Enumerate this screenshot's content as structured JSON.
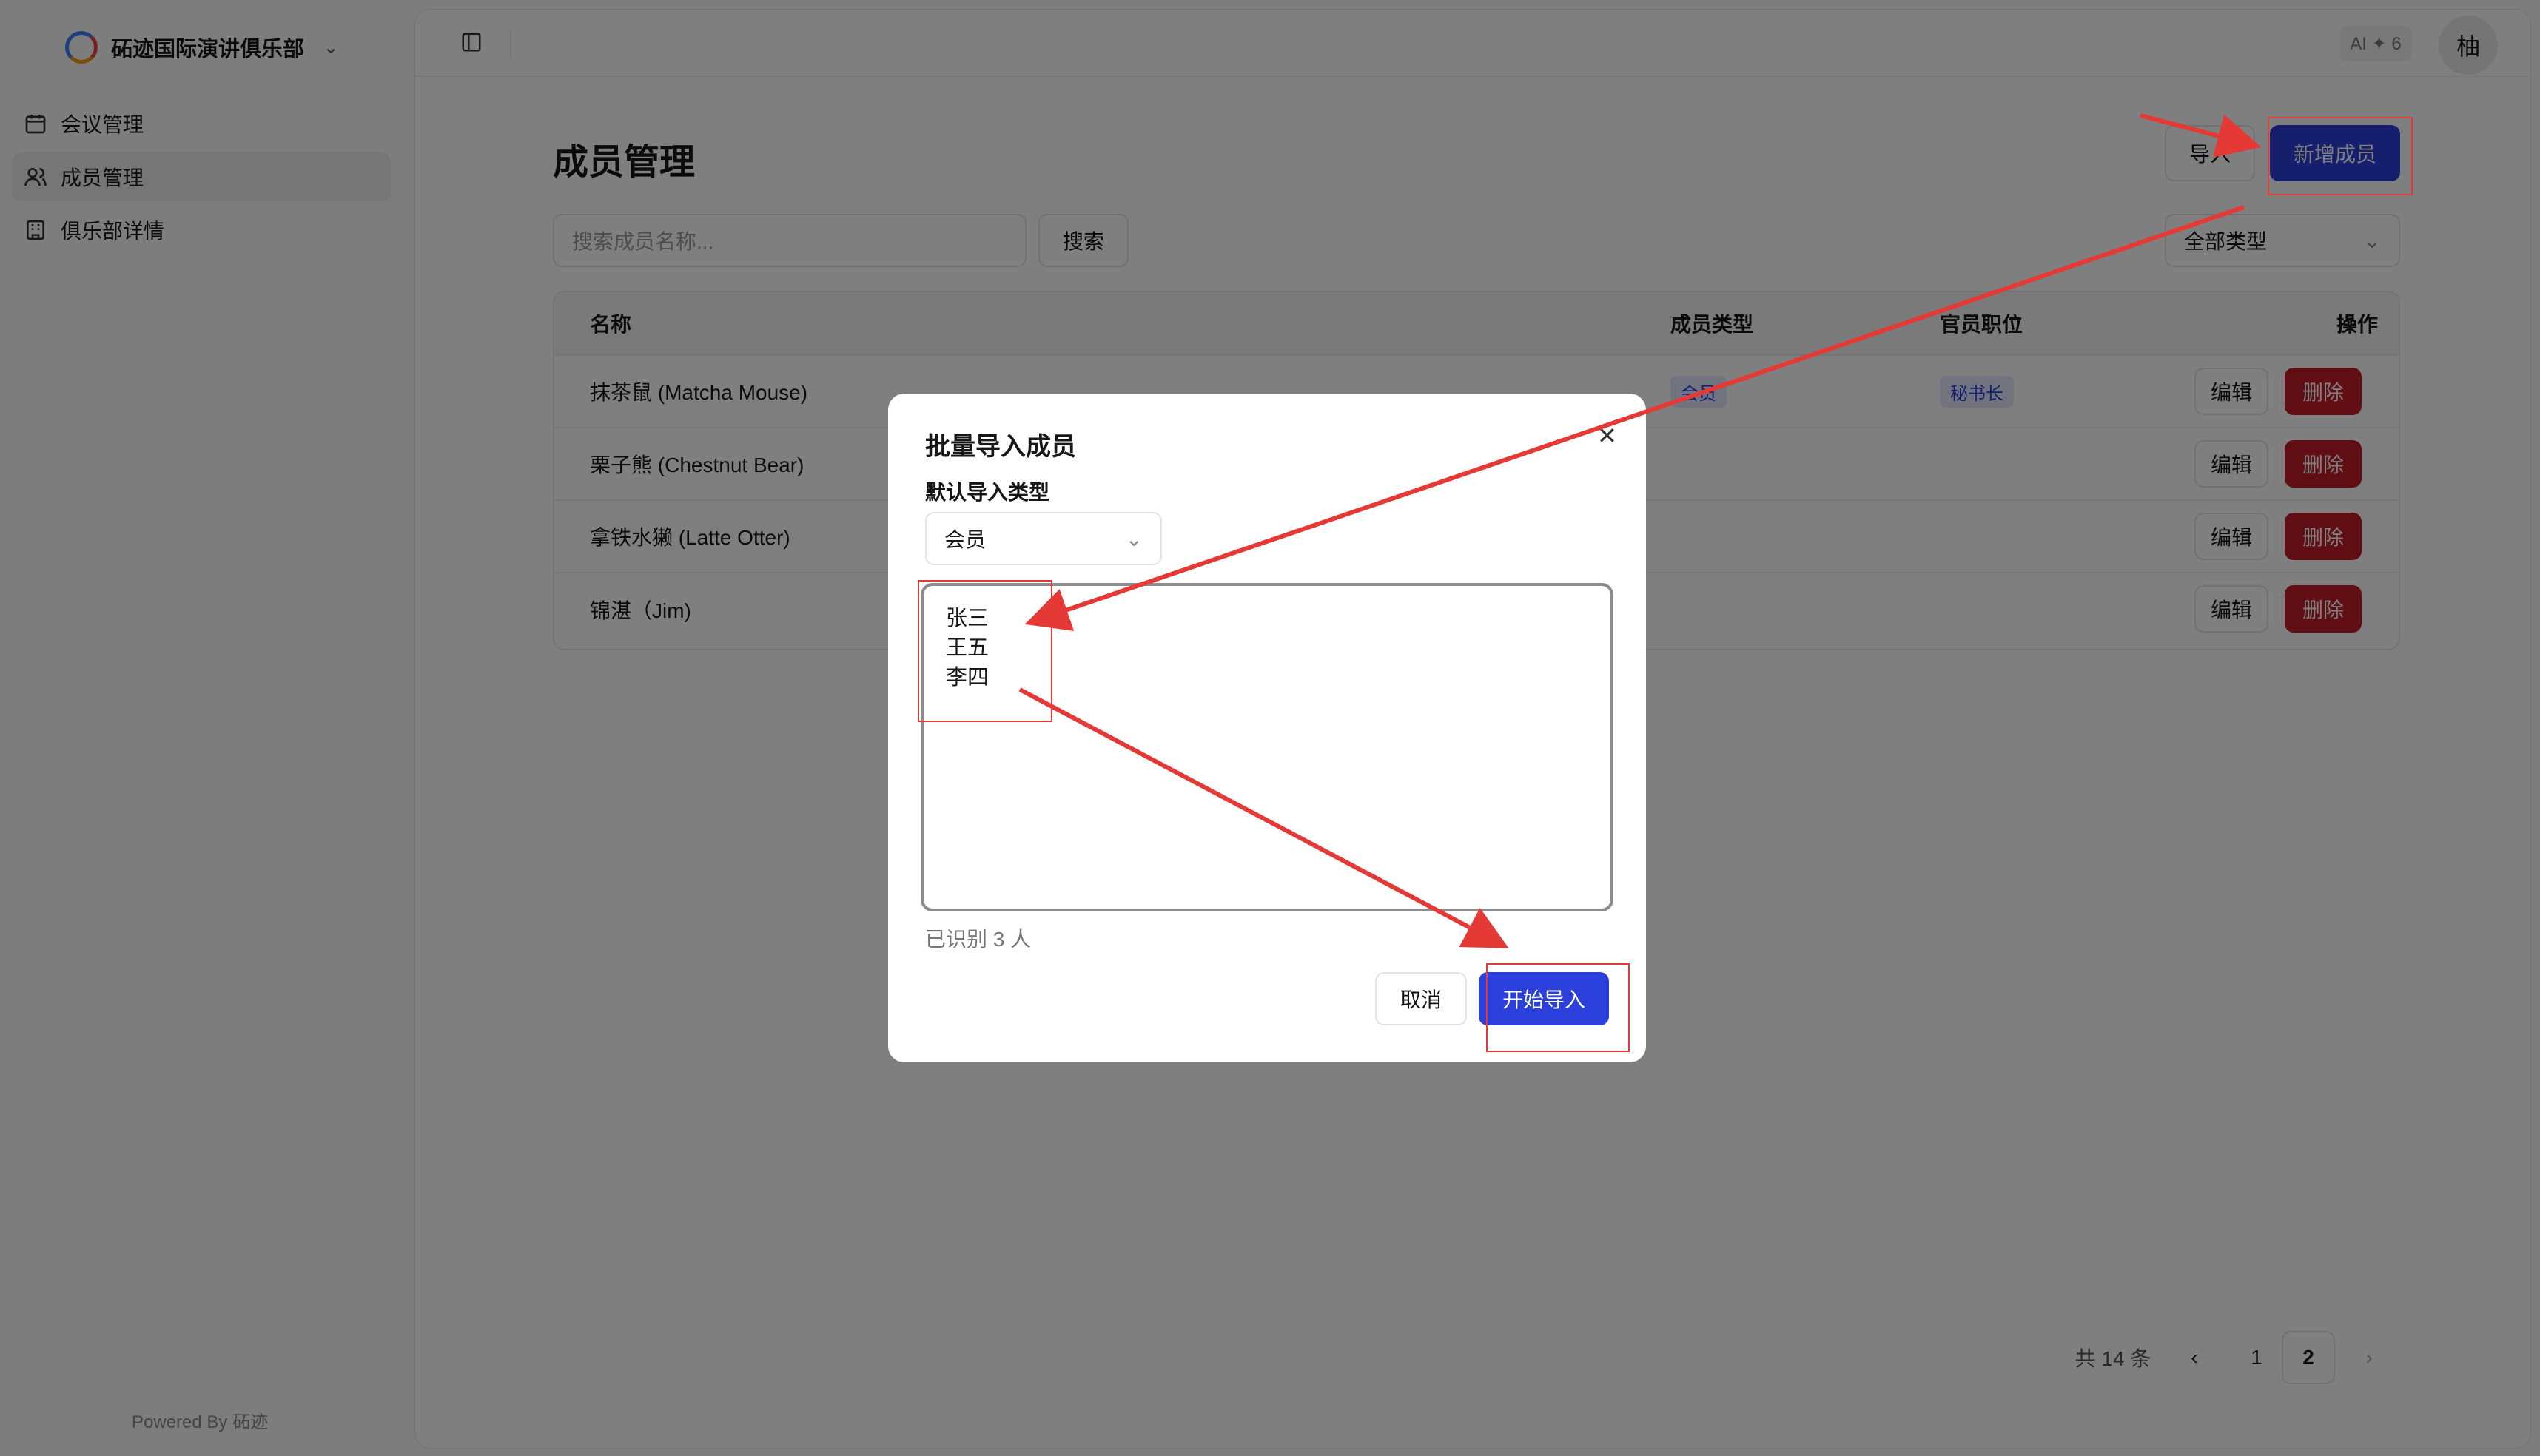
{
  "sidebar": {
    "org_name": "砳迹国际演讲俱乐部",
    "items": [
      {
        "label": "会议管理"
      },
      {
        "label": "成员管理"
      },
      {
        "label": "俱乐部详情"
      }
    ],
    "powered_by": "Powered By 砳迹"
  },
  "header": {
    "ai_badge": "AI ✦ 6",
    "avatar_initial": "柚"
  },
  "page": {
    "title": "成员管理",
    "import_label": "导入",
    "add_member_label": "新增成员",
    "search_placeholder": "搜索成员名称...",
    "search_button": "搜索",
    "type_filter": "全部类型"
  },
  "table": {
    "columns": [
      "名称",
      "成员类型",
      "官员职位",
      "操作"
    ],
    "rows": [
      {
        "name": "抹茶鼠 (Matcha Mouse)",
        "type": "会员",
        "position": "秘书长"
      },
      {
        "name": "栗子熊 (Chestnut Bear)",
        "type": "",
        "position": ""
      },
      {
        "name": "拿铁水獭 (Latte Otter)",
        "type": "",
        "position": ""
      },
      {
        "name": "锦湛（Jim)",
        "type": "",
        "position": ""
      }
    ],
    "edit_label": "编辑",
    "delete_label": "删除"
  },
  "pagination": {
    "total_text": "共 14 条",
    "pages": [
      "1",
      "2"
    ],
    "current": "2"
  },
  "dialog": {
    "title": "批量导入成员",
    "default_type_label": "默认导入类型",
    "default_type_value": "会员",
    "textarea_lines": [
      "张三",
      "王五",
      "李四"
    ],
    "recognized_text": "已识别 3 人",
    "cancel_label": "取消",
    "start_label": "开始导入"
  },
  "colors": {
    "primary": "#2a3fdc",
    "danger": "#c01c28",
    "annotation": "#e53935"
  }
}
